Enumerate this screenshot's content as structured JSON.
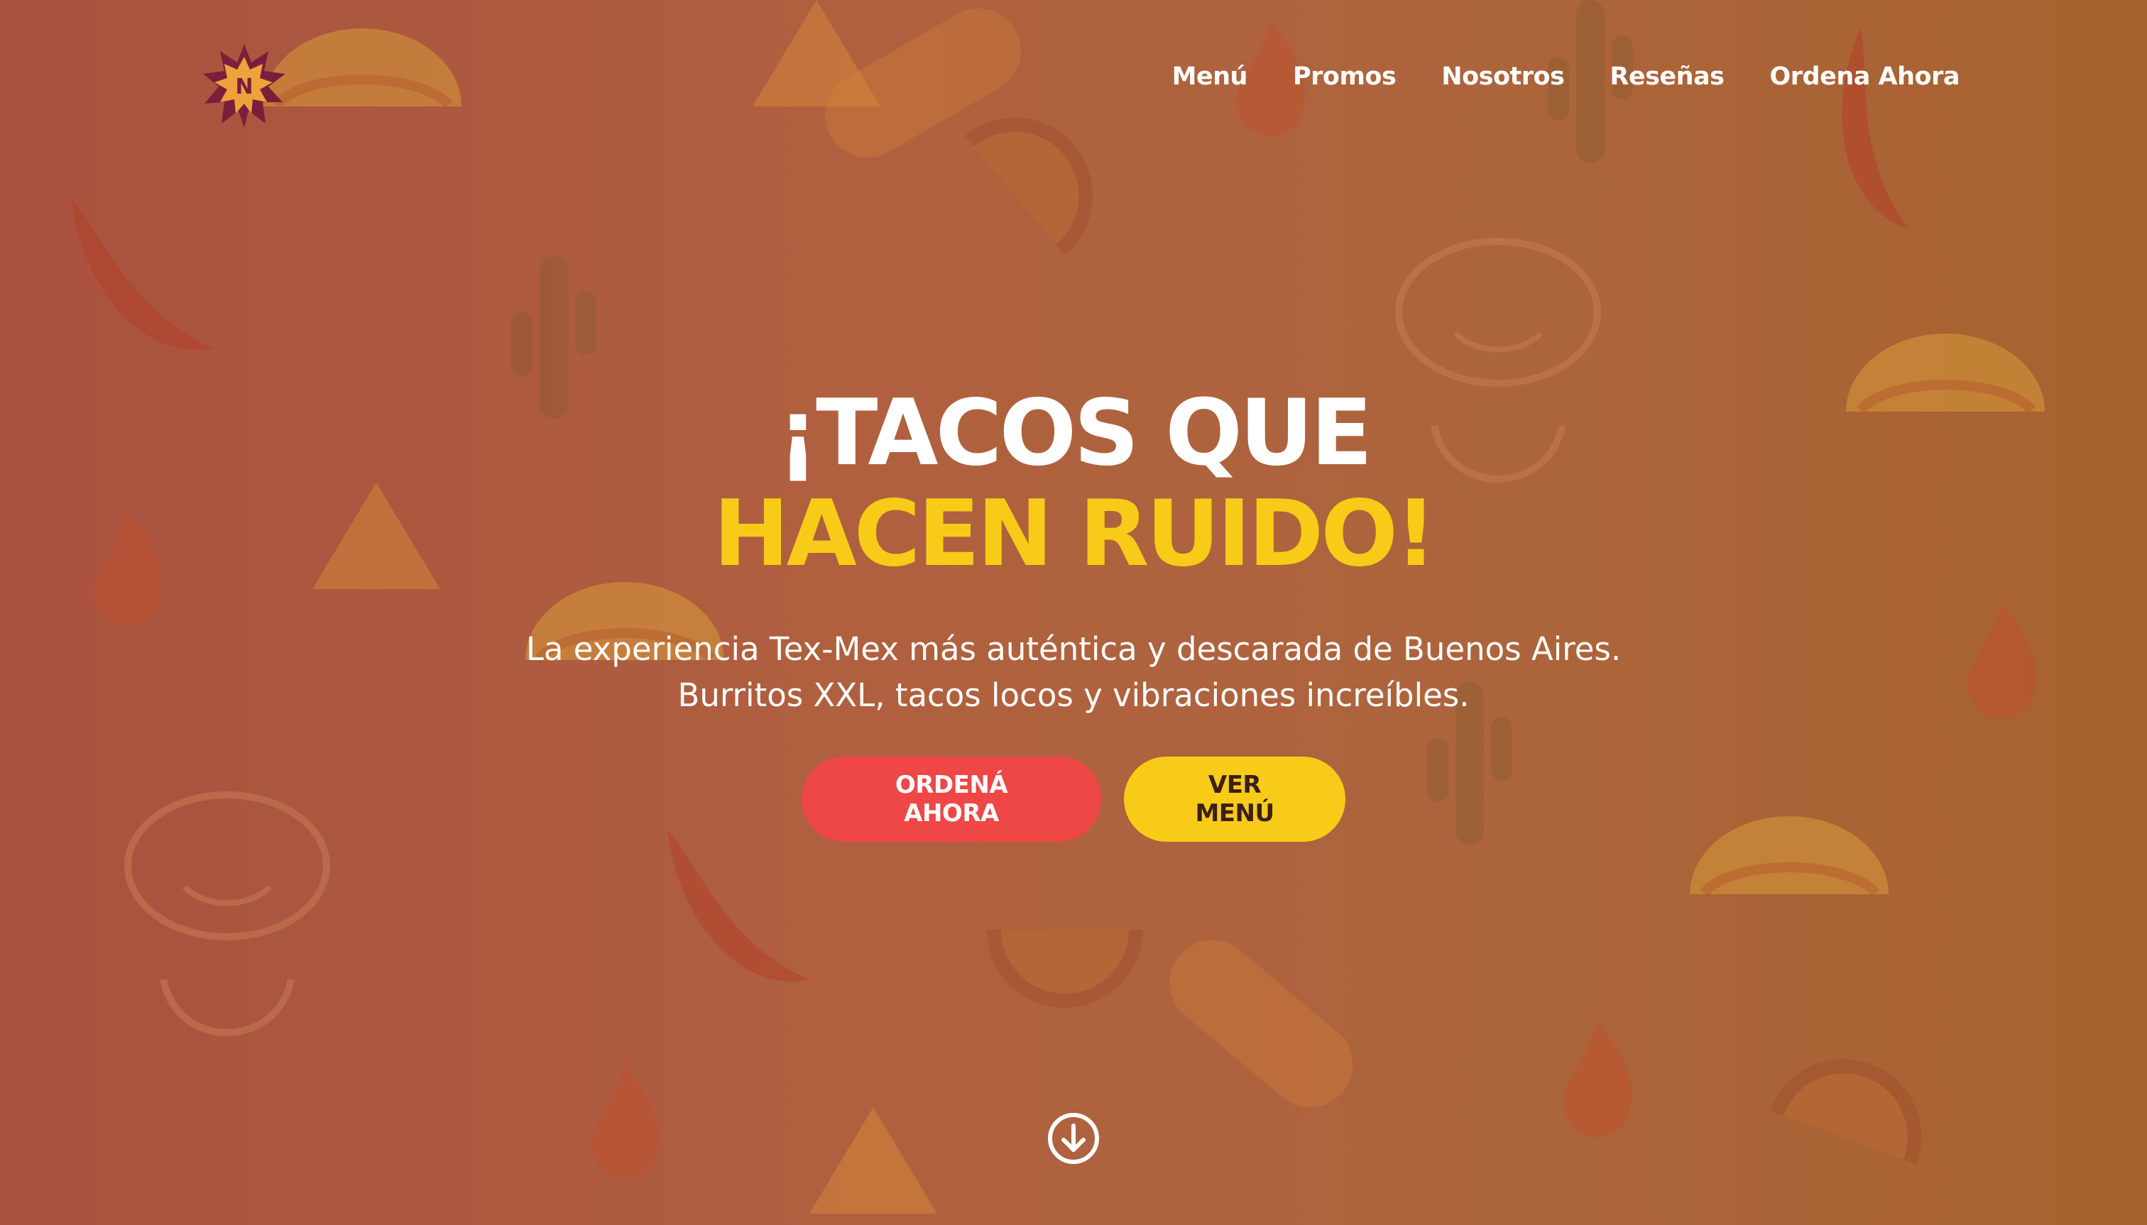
{
  "brand": {
    "logo_letter": "N",
    "colors": {
      "primary": "#ef4646",
      "accent": "#f7cb17",
      "dark": "#3a1f14",
      "logo_burst": "#7a1f3b"
    }
  },
  "nav": {
    "items": [
      {
        "label": "Menú"
      },
      {
        "label": "Promos"
      },
      {
        "label": "Nosotros"
      },
      {
        "label": "Reseñas"
      },
      {
        "label": "Ordena Ahora"
      }
    ]
  },
  "hero": {
    "title_line1": "¡TACOS QUE",
    "title_line2": "HACEN RUIDO!",
    "subtitle": "La experiencia Tex-Mex más auténtica y descarada de Buenos Aires. Burritos XXL, tacos locos y vibraciones increíbles.",
    "cta_primary": "ORDENÁ AHORA",
    "cta_secondary": "VER MENÚ"
  },
  "icons": {
    "scroll": "arrow-down-circle-icon",
    "background": [
      "taco-icon",
      "burrito-icon",
      "chili-pepper-icon",
      "cactus-icon",
      "lime-slice-icon",
      "nacho-chip-icon",
      "flame-icon",
      "axolotl-icon"
    ]
  }
}
